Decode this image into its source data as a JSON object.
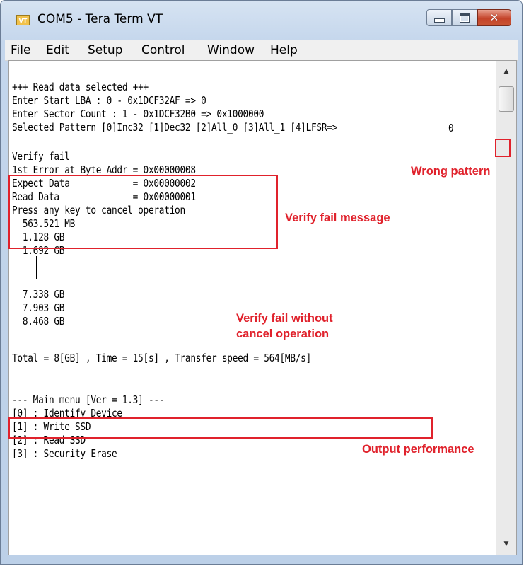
{
  "window": {
    "title": "COM5 - Tera Term VT",
    "icon_text": "VT"
  },
  "menu": [
    "File",
    "Edit",
    "Setup",
    "Control",
    "Window",
    "Help"
  ],
  "terminal": {
    "l1": "+++ Read data selected +++",
    "l2": "Enter Start LBA : 0 - 0x1DCF32AF => 0",
    "l3": "Enter Sector Count : 1 - 0x1DCF32B0 => 0x1000000",
    "l4": "Selected Pattern [0]Inc32 [1]Dec32 [2]All_0 [3]All_1 [4]LFSR=>",
    "l4_value": "0",
    "l5": "Verify fail",
    "l6": "1st Error at Byte Addr = 0x00000008",
    "l7": "Expect Data            = 0x00000002",
    "l8": "Read Data              = 0x00000001",
    "l9": "Press any key to cancel operation",
    "l10": "  563.521 MB",
    "l11": "  1.128 GB",
    "l12": "  1.692 GB",
    "l13": "  7.338 GB",
    "l14": "  7.903 GB",
    "l15": "  8.468 GB",
    "l16": "Total = 8[GB] , Time = 15[s] , Transfer speed = 564[MB/s]",
    "l17": "--- Main menu [Ver = 1.3] ---",
    "l18": "[0] : Identify Device",
    "l19": "[1] : Write SSD",
    "l20": "[2] : Read SSD",
    "l21": "[3] : Security Erase"
  },
  "annotations": {
    "wrong_pattern": "Wrong pattern",
    "verify_fail_message": "Verify fail message",
    "verify_fail_without_1": "Verify fail without",
    "verify_fail_without_2": "cancel operation",
    "output_performance": "Output performance"
  },
  "colors": {
    "annotation_red": "#e0222c"
  }
}
